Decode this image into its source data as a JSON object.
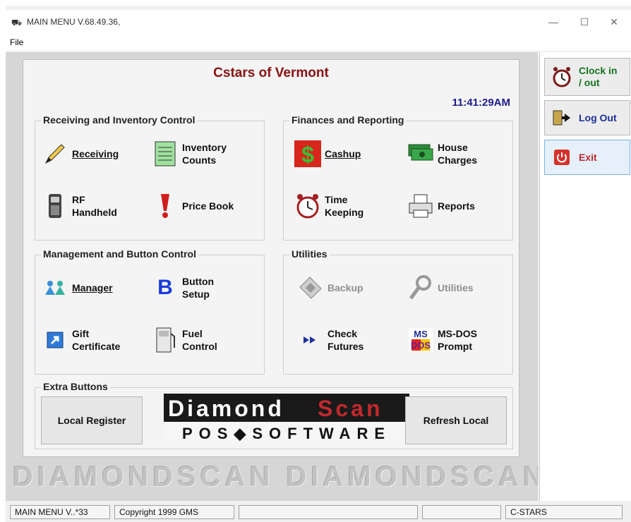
{
  "window": {
    "title": "MAIN MENU V.68.49.36,",
    "menu": [
      "File"
    ]
  },
  "header": {
    "store_name": "Cstars of Vermont",
    "time": "11:41:29AM"
  },
  "groups": {
    "receiving": {
      "title": "Receiving and Inventory Control",
      "buttons": [
        {
          "label": "Receiving",
          "icon": "pencil-icon"
        },
        {
          "label": "Inventory\nCounts",
          "icon": "inventory-list-icon"
        },
        {
          "label": "RF\nHandheld",
          "icon": "handheld-scanner-icon"
        },
        {
          "label": "Price Book",
          "icon": "exclamation-icon"
        }
      ]
    },
    "finances": {
      "title": "Finances and Reporting",
      "buttons": [
        {
          "label": "Cashup",
          "icon": "dollar-icon"
        },
        {
          "label": "House\nCharges",
          "icon": "money-icon"
        },
        {
          "label": "Time\nKeeping",
          "icon": "alarm-clock-icon"
        },
        {
          "label": "Reports",
          "icon": "printer-icon"
        }
      ]
    },
    "management": {
      "title": "Management and Button Control",
      "buttons": [
        {
          "label": "Manager",
          "icon": "people-icon"
        },
        {
          "label": "Button\nSetup",
          "icon": "letter-b-icon"
        },
        {
          "label": "Gift\nCertificate",
          "icon": "shortcut-arrow-icon"
        },
        {
          "label": "Fuel\nControl",
          "icon": "fuel-pump-icon"
        }
      ]
    },
    "utilities": {
      "title": "Utilities",
      "buttons": [
        {
          "label": "Backup",
          "icon": "floppy-icon",
          "disabled": true
        },
        {
          "label": "Utilities",
          "icon": "wrench-icon",
          "disabled": true
        },
        {
          "label": "Check\nFutures",
          "icon": "fast-forward-icon"
        },
        {
          "label": "MS-DOS\nPrompt",
          "icon": "msdos-icon"
        }
      ]
    },
    "extra": {
      "title": "Extra Buttons",
      "local_register": "Local Register",
      "refresh_local": "Refresh Local",
      "logo_top": "Diamond",
      "logo_top2": "Scan",
      "logo_bottom": "POS◆SOFTWARE"
    }
  },
  "watermark": "DIAMONDSCAN  DIAMONDSCAN  DI",
  "sidebar": {
    "clock_in": "Clock in\n/ out",
    "log_out": "Log Out",
    "exit": "Exit"
  },
  "statusbar": {
    "s1": "MAIN MENU V..*33",
    "s2": "Copyright 1999 GMS",
    "s3": "",
    "s4": "",
    "s5": "C-STARS"
  },
  "colors": {
    "title_red": "#8b1010",
    "clock_blue": "#1b1b8a",
    "sidebar_green": "#14741d",
    "exit_red": "#c0282c"
  }
}
